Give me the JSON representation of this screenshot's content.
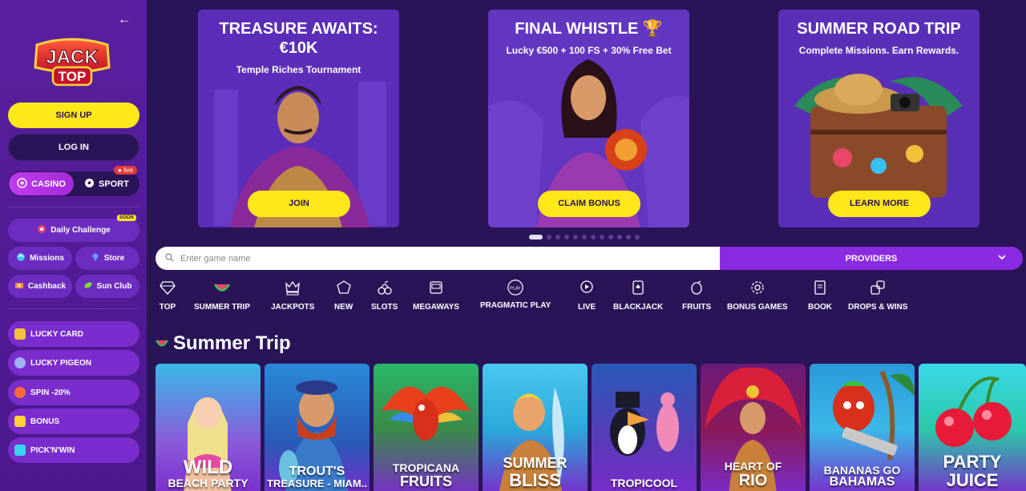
{
  "sidebar": {
    "logo_text_top": "JACK",
    "logo_text_bottom": "TOP",
    "signup": "SIGN UP",
    "login": "LOG IN",
    "casino": "CASINO",
    "sport": "SPORT",
    "live": "live",
    "daily_challenge": "Daily Challenge",
    "soon": "SOON",
    "missions": "Missions",
    "store": "Store",
    "cashback": "Cashback",
    "sun_club": "Sun Club",
    "promos": [
      "LUCKY CARD",
      "LUCKY PIGEON",
      "SPIN -20%",
      "BONUS",
      "PICK'N'WIN"
    ]
  },
  "banners": [
    {
      "title": "TREASURE AWAITS: €10K",
      "subtitle": "Temple Riches Tournament",
      "button": "JOIN"
    },
    {
      "title": "FINAL WHISTLE 🏆",
      "subtitle": "Lucky €500 + 100 FS + 30% Free Bet",
      "button": "CLAIM BONUS"
    },
    {
      "title": "SUMMER ROAD TRIP",
      "subtitle": "Complete Missions. Earn Rewards.",
      "button": "LEARN MORE"
    }
  ],
  "search": {
    "placeholder": "Enter game name"
  },
  "providers": "PROVIDERS",
  "categories": [
    "TOP",
    "SUMMER TRIP",
    "JACKPOTS",
    "NEW",
    "SLOTS",
    "MEGAWAYS",
    "PRAGMATIC PLAY",
    "LIVE",
    "BLACKJACK",
    "FRUITS",
    "BONUS GAMES",
    "BOOK",
    "DROPS & WINS"
  ],
  "section_title": "Summer Trip",
  "games": [
    {
      "l1": "WILD",
      "l2": "BEACH PARTY"
    },
    {
      "l1": "TROUT'S",
      "l2": "TREASURE - MIAM.."
    },
    {
      "l1": "TROPICANA",
      "l2": "FRUITS"
    },
    {
      "l1": "SUMMER",
      "l2": "BLISS"
    },
    {
      "l1": "",
      "l2": "TROPICOOL"
    },
    {
      "l1": "HEART OF",
      "l2": "RIO"
    },
    {
      "l1": "BANANAS GO",
      "l2": "BAHAMAS"
    },
    {
      "l1": "PARTY",
      "l2": "JUICE"
    }
  ],
  "colors": {
    "accent_yellow": "#ffe81a",
    "purple": "#8a2be2",
    "bg": "#2a1458"
  }
}
